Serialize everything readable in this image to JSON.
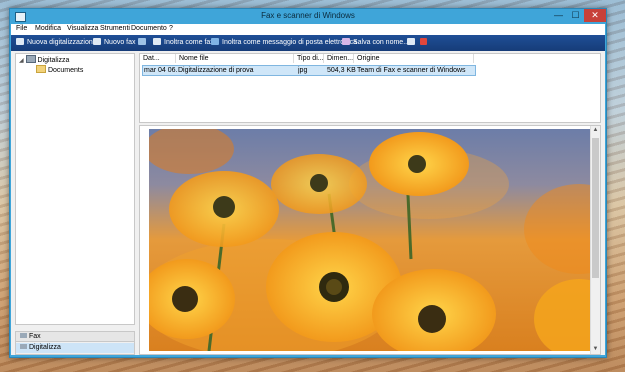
{
  "window": {
    "title": "Fax e scanner di Windows"
  },
  "controls": {
    "minimize": "—",
    "maximize": "☐",
    "close": "✕"
  },
  "menu": [
    "File",
    "Modifica",
    "Visualizza",
    "Strumenti",
    "Documento",
    "?"
  ],
  "toolbar": {
    "new_scan": "Nuova digitalizzazione",
    "new_fax": "Nuovo fax",
    "forward_fax": "Inoltra come fax",
    "forward_email": "Inoltra come messaggio di posta elettronica",
    "save_as": "Salva con nome..."
  },
  "tree": {
    "root": "Digitalizza",
    "child": "Documents"
  },
  "nav": {
    "fax": "Fax",
    "scan": "Digitalizza"
  },
  "list": {
    "columns": [
      "Dat...",
      "Nome file",
      "Tipo di...",
      "Dimen...",
      "Origine"
    ],
    "rows": [
      [
        "mar 04 06...",
        "Digitalizzazione di prova",
        "jpg",
        "504,3 KB",
        "Team di Fax e scanner di Windows"
      ]
    ]
  },
  "colors": {
    "accent": "#3fa5d9",
    "toolbar": "#1f4f97",
    "selection": "#cfe6f8",
    "close": "#c7413a"
  },
  "preview": {
    "subject": "orange-daisies-photo"
  }
}
